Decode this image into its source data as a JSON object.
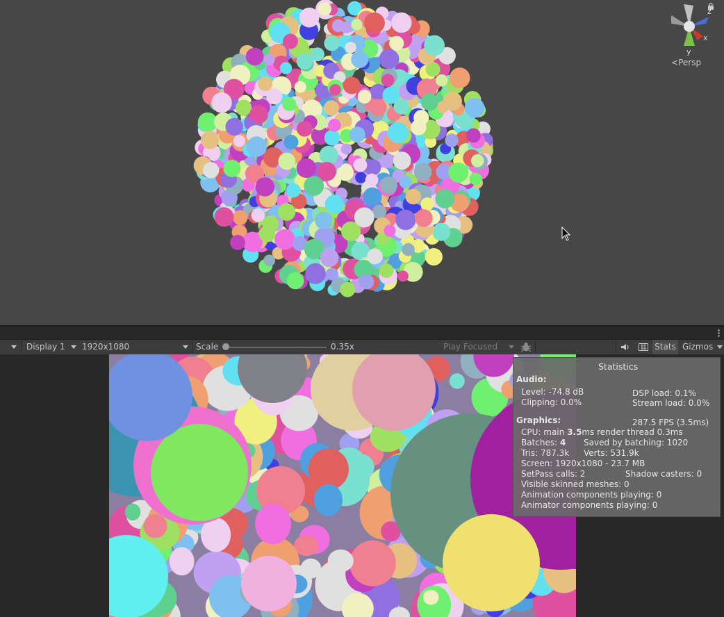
{
  "scene": {
    "persp_label": "Persp",
    "axes": {
      "x": "x",
      "y": "y",
      "z": "z"
    }
  },
  "toolbar": {
    "display": "Display 1",
    "resolution": "1920x1080",
    "scale_label": "Scale",
    "scale_value": "0.35x",
    "scale_fraction": 0.0,
    "play_mode": "Play Focused",
    "stats_label": "Stats",
    "gizmos_label": "Gizmos"
  },
  "stats": {
    "title": "Statistics",
    "audio_header": "Audio:",
    "level": "Level: -74.8 dB",
    "dsp_load": "DSP load: 0.1%",
    "clipping": "Clipping: 0.0%",
    "stream_load": "Stream load: 0.0%",
    "graphics_header": "Graphics:",
    "fps": "287.5 FPS (3.5ms)",
    "cpu_prefix": "CPU: main ",
    "cpu_main": "3.5",
    "cpu_suffix": "ms  render thread 0.3ms",
    "batches_prefix": "Batches: ",
    "batches": "4",
    "saved_batching": "Saved by batching: 1020",
    "tris": "Tris: 787.3k",
    "verts": "Verts: 531.9k",
    "screen": "Screen: 1920x1080 - 23.7 MB",
    "setpass": "SetPass calls: 2",
    "shadow_casters": "Shadow casters: 0",
    "visible_skinned": "Visible skinned meshes: 0",
    "animation_components": "Animation components playing: 0",
    "animator_components": "Animator components playing: 0"
  }
}
